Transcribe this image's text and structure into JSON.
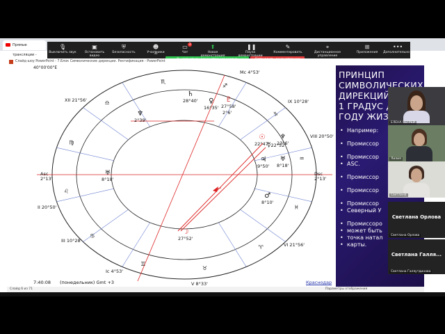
{
  "browser": {
    "tab_title": "Прямые трансляции -"
  },
  "zoom_toolbar": {
    "buttons": [
      {
        "label": "Выключить звук",
        "icon": "microphone-icon"
      },
      {
        "label": "Остановить видео",
        "icon": "video-camera-icon"
      },
      {
        "label": "Безопасность",
        "icon": "shield-icon"
      },
      {
        "label": "Участники",
        "icon": "participants-icon",
        "count": "30"
      },
      {
        "label": "Чат",
        "icon": "chat-icon",
        "badge": "3"
      },
      {
        "label": "Новая демонстрация",
        "icon": "share-screen-icon"
      },
      {
        "label": "Пауза демонстрации",
        "icon": "pause-icon"
      },
      {
        "label": "Комментировать",
        "icon": "pencil-icon"
      },
      {
        "label": "Дистанционное управление",
        "icon": "remote-control-icon"
      },
      {
        "label": "Приложения",
        "icon": "apps-icon"
      },
      {
        "label": "Дополнительно",
        "icon": "more-icon"
      }
    ],
    "share_notice": "Вы запустили демонстрацию экрана",
    "stop_share": "Остановить демонстрацию"
  },
  "powerpoint": {
    "window_title": "Слайд-шоу PowerPoint - 7.Блок Символические дирекции. Ректификация - PowerPoint",
    "status_slide": "Слайд 6 из 71",
    "status_notes": "Параметры отображения"
  },
  "chart": {
    "top_left_label": "40°00'00\"E",
    "houses": {
      "mc": "Mc 4°53'",
      "xii": "XII 21°56'",
      "xi": "XI 21°56'",
      "ix": "IX 10°28'",
      "viii": "VIII 20°50'",
      "asc": "Asc",
      "asc_deg": "2°13'",
      "dsc": "Dsc",
      "dsc_deg": "2°13'",
      "ii": "II 20°50'",
      "iii": "III 10°28'",
      "vi": "VI 21°56'",
      "ic": "Ic 4°53'",
      "v": "V 8°33'"
    },
    "planets": [
      {
        "glyph": "♆",
        "deg": "2°39'"
      },
      {
        "glyph": "♄",
        "deg": "28°40'"
      },
      {
        "glyph": "♀",
        "deg": "16°35'"
      },
      {
        "glyph": "♇",
        "deg": "27°58'"
      },
      {
        "glyph": "♇",
        "deg": "2°6'"
      },
      {
        "glyph": "☉",
        "deg": "22°47'"
      },
      {
        "glyph": "♆",
        "deg": "23°6'"
      },
      {
        "glyph": "☿",
        "deg": "22°52'"
      },
      {
        "glyph": "♃",
        "deg": "9°50'"
      },
      {
        "glyph": "♅",
        "deg": "8°18'"
      },
      {
        "glyph": "♅",
        "deg": "8°18'"
      },
      {
        "glyph": "♂",
        "deg": "8°10'"
      },
      {
        "glyph": "☽",
        "deg": "27°52'"
      }
    ],
    "signs": [
      "♓",
      "♈",
      "♉",
      "♊",
      "♋",
      "♌",
      "♍",
      "♎",
      "♏",
      "♐",
      "♑",
      "♒"
    ],
    "bottom_time": "7:40:08",
    "bottom_date": "(понедельник) Gmt +3",
    "bottom_place": "Краснодар"
  },
  "slide_text": {
    "title_lines": [
      "ПРИНЦИП",
      "СИМВОЛИЧЕСКИХ",
      "ДИРЕКЦИЙ:",
      "1 ГРАДУС ДУГИ",
      "ГОДУ ЖИЗНИ"
    ],
    "bullets": [
      "Например:",
      "Промиссор",
      "Промиссор",
      "ASC.",
      "Промиссор",
      "Промиссор",
      "Промиссор",
      "Северный У",
      "Промиссоро",
      "может быть",
      "точка натал",
      "карты."
    ]
  },
  "participants": [
    {
      "name": "ЕЛЕНА НЕГРЕЙ"
    },
    {
      "name": "Лилия"
    },
    {
      "name": "Светлана"
    },
    {
      "name": "Светлана Орлова",
      "big": "Светлана Орлова"
    },
    {
      "name": "Светлана Галяутдинова",
      "big": "Светлана Галля..."
    }
  ]
}
